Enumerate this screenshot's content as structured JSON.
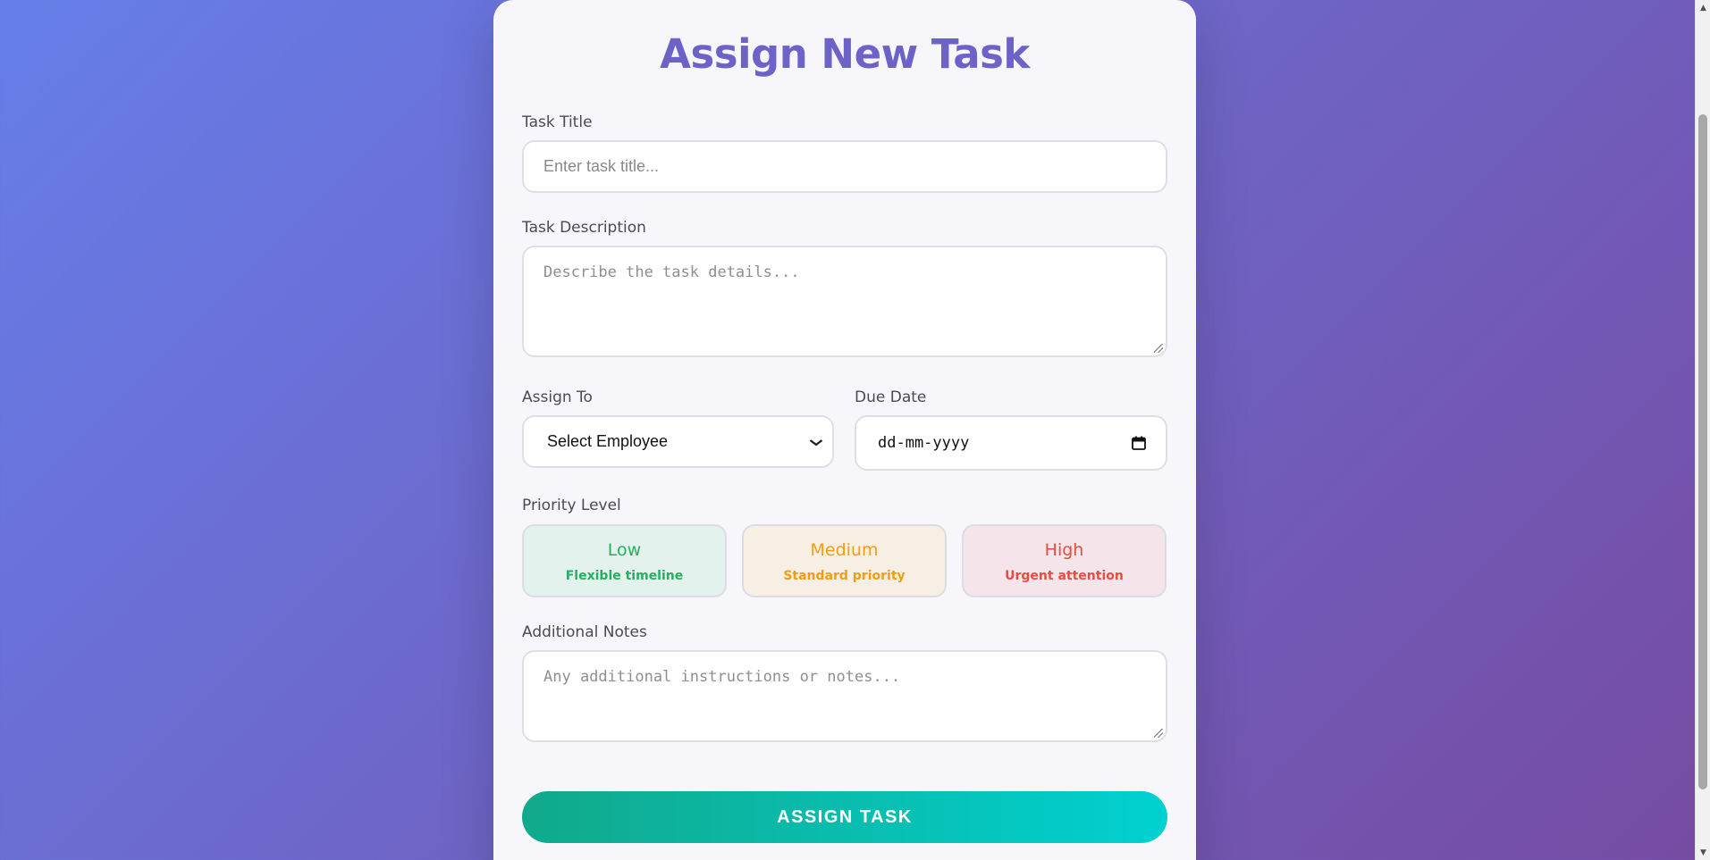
{
  "form": {
    "title": "Assign New Task",
    "task_title": {
      "label": "Task Title",
      "placeholder": "Enter task title..."
    },
    "task_description": {
      "label": "Task Description",
      "placeholder": "Describe the task details..."
    },
    "assign_to": {
      "label": "Assign To",
      "selected": "Select Employee"
    },
    "due_date": {
      "label": "Due Date",
      "value": "dd-mm-yyyy"
    },
    "priority": {
      "label": "Priority Level",
      "options": [
        {
          "name": "Low",
          "desc": "Flexible timeline",
          "color": "#27ae60",
          "bg": "#e3f2ec"
        },
        {
          "name": "Medium",
          "desc": "Standard priority",
          "color": "#f39c12",
          "bg": "#f7efe4"
        },
        {
          "name": "High",
          "desc": "Urgent attention",
          "color": "#e74c3c",
          "bg": "#f5e5ea"
        }
      ]
    },
    "notes": {
      "label": "Additional Notes",
      "placeholder": "Any additional instructions or notes..."
    },
    "submit_label": "ASSIGN TASK"
  },
  "colors": {
    "background_start": "#667eea",
    "background_end": "#764ba2",
    "title": "#6c62c7",
    "button_start": "#11a98b",
    "button_end": "#00d1d1"
  },
  "icons": {
    "select_arrow": "chevron-down-icon",
    "date_picker": "calendar-icon"
  }
}
